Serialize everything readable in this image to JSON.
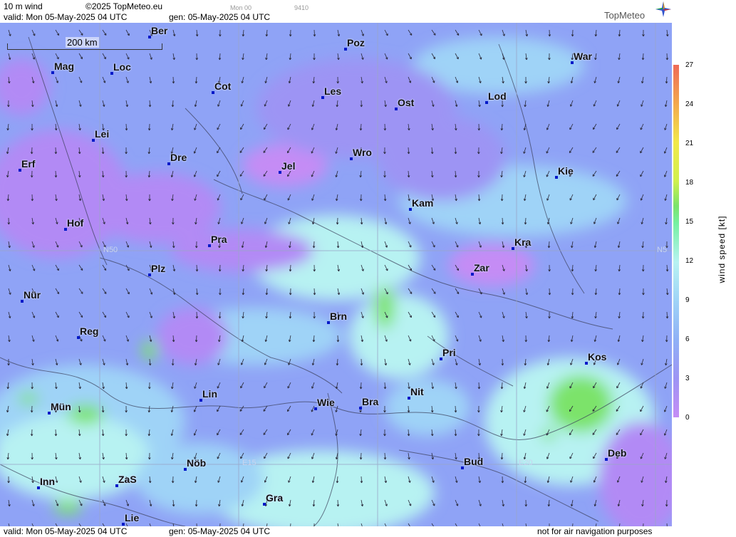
{
  "header": {
    "variable": "10 m wind",
    "copyright": "©2025 TopMeteo.eu",
    "valid": "valid:  Mon  05-May-2025  04 UTC",
    "gen": "gen: 05-May-2025 04 UTC",
    "frame_label": "Mon 00",
    "frame_code": "9410",
    "logo": "TopMeteo"
  },
  "footer": {
    "valid": "valid:  Mon  05-May-2025  04 UTC",
    "gen": "gen: 05-May-2025 04 UTC",
    "disclaimer": "not for air navigation purposes"
  },
  "scale": {
    "label": "200 km"
  },
  "legend": {
    "title": "wind  speed  [kt]",
    "ticks": [
      "27",
      "24",
      "21",
      "18",
      "15",
      "12",
      "9",
      "6",
      "3",
      "0"
    ],
    "colors": [
      "#ee6a57",
      "#f3a84e",
      "#f2e84a",
      "#d0f04f",
      "#7be36b",
      "#b7f2f2",
      "#9fd3f7",
      "#8fb1f6",
      "#9d94f4",
      "#c58cf5"
    ]
  },
  "grid_labels": [
    "N50",
    "N5",
    "E15",
    "E20"
  ],
  "cities": [
    "Ber",
    "Poz",
    "War",
    "Mag",
    "Loc",
    "Cot",
    "Les",
    "Ost",
    "Lod",
    "Lei",
    "Erf",
    "Dre",
    "Wro",
    "Jel",
    "Kie",
    "Kam",
    "Hof",
    "Pra",
    "Kra",
    "Plz",
    "Zar",
    "Nür",
    "Brn",
    "Reg",
    "Pri",
    "Kos",
    "Lin",
    "Mün",
    "Wie",
    "Bra",
    "Nit",
    "Deb",
    "Nöb",
    "Bud",
    "Inn",
    "ZaS",
    "Gra",
    "Lie"
  ],
  "colors": {
    "low_wind": "#c58cf5",
    "mid_low": "#9d94f4",
    "mid": "#8fa3f6",
    "mid_high": "#9fd3f7",
    "high": "#b7f2f2",
    "green": "#7be36b",
    "city_marker": "#0018c8"
  }
}
